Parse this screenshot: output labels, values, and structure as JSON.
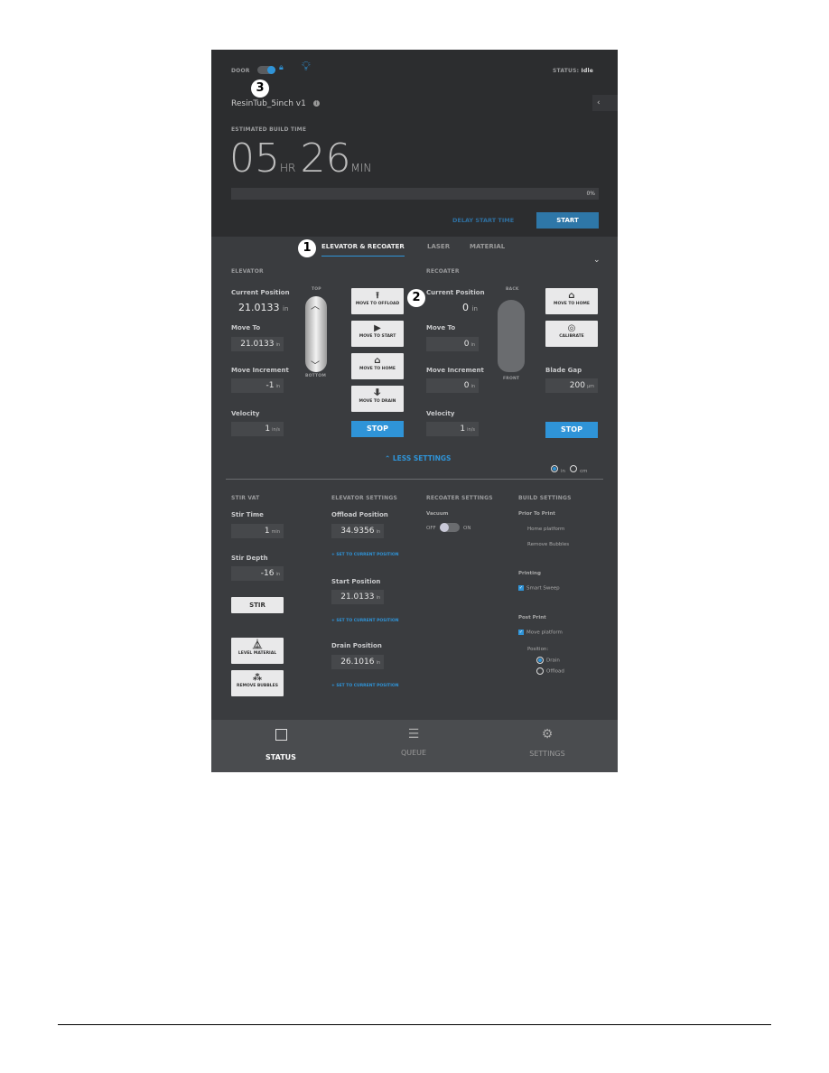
{
  "header": {
    "door_label": "DOOR",
    "status_label": "STATUS:",
    "status_value": "Idle",
    "file_name": "ResinTub_5inch v1",
    "est_label": "ESTIMATED BUILD TIME",
    "hours": "05",
    "hr_unit": "HR",
    "minutes": "26",
    "min_unit": "MIN",
    "progress_text": "0%",
    "progress": 0,
    "delay_label": "DELAY START TIME",
    "start_label": "START"
  },
  "tabs": [
    {
      "label": "ELEVATOR & RECOATER",
      "active": true
    },
    {
      "label": "LASER"
    },
    {
      "label": "MATERIAL"
    }
  ],
  "callouts": [
    "1",
    "2",
    "3"
  ],
  "elevator": {
    "title": "ELEVATOR",
    "current_label": "Current Position",
    "current_value": "21.0133",
    "unit": "in",
    "move_to_label": "Move To",
    "move_to": "21.0133",
    "inc_label": "Move Increment",
    "inc": "-1",
    "vel_label": "Velocity",
    "vel": "1",
    "vel_unit": "in/s",
    "top": "TOP",
    "bottom": "BOTTOM",
    "buttons": [
      "MOVE TO OFFLOAD",
      "MOVE TO START",
      "MOVE TO HOME",
      "MOVE TO DRAIN"
    ],
    "stop": "STOP"
  },
  "recoater": {
    "title": "RECOATER",
    "current_label": "Current Position",
    "current_value": "0",
    "unit": "in",
    "move_to_label": "Move To",
    "move_to": "0",
    "inc_label": "Move Increment",
    "inc": "0",
    "vel_label": "Velocity",
    "vel": "1",
    "vel_unit": "in/s",
    "back": "BACK",
    "front": "FRONT",
    "buttons": [
      "MOVE TO HOME",
      "CALIBRATE"
    ],
    "blade_label": "Blade Gap",
    "blade": "200",
    "blade_unit": "µm",
    "stop": "STOP"
  },
  "less_settings": "LESS SETTINGS",
  "units": {
    "in": "in",
    "cm": "cm",
    "selected": "in"
  },
  "stir": {
    "title": "STIR VAT",
    "time_label": "Stir Time",
    "time": "1",
    "time_unit": "min",
    "depth_label": "Stir Depth",
    "depth": "-16",
    "depth_unit": "in",
    "stir_btn": "STIR",
    "level_btn": "LEVEL MATERIAL",
    "bubbles_btn": "REMOVE BUBBLES"
  },
  "elev_settings": {
    "title": "ELEVATOR SETTINGS",
    "offload_label": "Offload Position",
    "offload": "34.9356",
    "start_label": "Start Position",
    "start": "21.0133",
    "drain_label": "Drain Position",
    "drain": "26.1016",
    "unit": "in",
    "set_link": "SET TO CURRENT POSITION"
  },
  "recoater_settings": {
    "title": "RECOATER SETTINGS",
    "vacuum_label": "Vacuum",
    "off": "OFF",
    "on": "ON"
  },
  "build_settings": {
    "title": "BUILD SETTINGS",
    "prior": "Prior To Print",
    "home_platform": "Home platform",
    "remove_bubbles": "Remove Bubbles",
    "printing": "Printing",
    "smart_sweep": "Smart Sweep",
    "post": "Post Print",
    "move_platform": "Move platform",
    "position": "Position:",
    "drain": "Drain",
    "offload": "Offload"
  },
  "nav": [
    {
      "label": "STATUS",
      "active": true
    },
    {
      "label": "QUEUE"
    },
    {
      "label": "SETTINGS"
    }
  ],
  "colors": {
    "accent": "#2f94d8",
    "bg": "#3a3c3f",
    "header": "#2c2d2f"
  }
}
